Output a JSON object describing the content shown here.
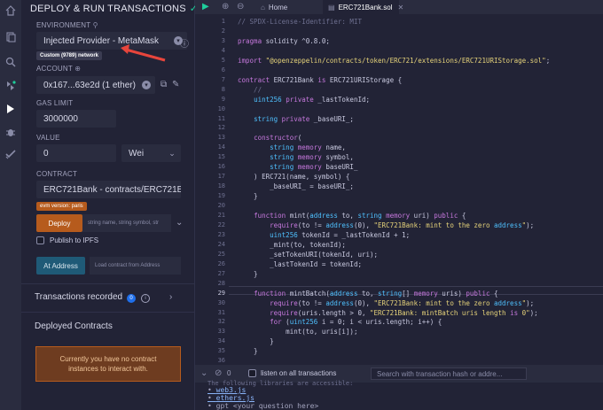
{
  "rail": {
    "icons": [
      "home-icon",
      "files-icon",
      "search-icon",
      "compile-icon",
      "deploy-icon",
      "debug-icon",
      "test-icon"
    ]
  },
  "panel": {
    "title": "DEPLOY & RUN TRANSACTIONS",
    "environment": {
      "label": "ENVIRONMENT",
      "value": "Injected Provider - MetaMask",
      "network_badge": "Custom (9789) network"
    },
    "account": {
      "label": "ACCOUNT",
      "value": "0x167...63e2d (1 ether)"
    },
    "gas_limit": {
      "label": "GAS LIMIT",
      "value": "3000000"
    },
    "value": {
      "label": "VALUE",
      "amount": "0",
      "unit": "Wei"
    },
    "contract": {
      "label": "CONTRACT",
      "value": "ERC721Bank - contracts/ERC721Bank",
      "evm_badge": "evm version: paris"
    },
    "deploy": {
      "button": "Deploy",
      "placeholder": "string name, string symbol, str"
    },
    "publish_ipfs": "Publish to IPFS",
    "at_address": {
      "button": "At Address",
      "placeholder": "Load contract from Address"
    },
    "transactions_recorded": {
      "label": "Transactions recorded",
      "count": "0"
    },
    "deployed_contracts": {
      "label": "Deployed Contracts",
      "empty_message": "Currently you have no contract instances to interact with."
    }
  },
  "editor": {
    "tabs": [
      {
        "label": "Home",
        "active": false
      },
      {
        "label": "ERC721Bank.sol",
        "active": true
      }
    ],
    "line_numbers": [
      "1",
      "2",
      "3",
      "4",
      "5",
      "6",
      "7",
      "8",
      "9",
      "10",
      "11",
      "12",
      "13",
      "14",
      "15",
      "16",
      "17",
      "18",
      "19",
      "20",
      "21",
      "22",
      "23",
      "24",
      "25",
      "26",
      "27",
      "28",
      "29",
      "30",
      "31",
      "32",
      "33",
      "34",
      "35",
      "36"
    ],
    "current_line": "29",
    "code_lines": [
      "// SPDX-License-Identifier: MIT",
      "",
      "pragma solidity ^0.8.0;",
      "",
      "import \"@openzeppelin/contracts/token/ERC721/extensions/ERC721URIStorage.sol\";",
      "",
      "contract ERC721Bank is ERC721URIStorage {",
      "    //",
      "    uint256 private _lastTokenId;",
      "",
      "    string private _baseURI_;",
      "",
      "    constructor(",
      "        string memory name,",
      "        string memory symbol,",
      "        string memory baseURI_",
      "    ) ERC721(name, symbol) {",
      "        _baseURI_ = baseURI_;",
      "    }",
      "",
      "    function mint(address to, string memory uri) public {",
      "        require(to != address(0), \"ERC721Bank: mint to the zero address\");",
      "        uint256 tokenId = _lastTokenId + 1;",
      "        _mint(to, tokenId);",
      "        _setTokenURI(tokenId, uri);",
      "        _lastTokenId = tokenId;",
      "    }",
      "",
      "    function mintBatch(address to, string[] memory uris) public {",
      "        require(to != address(0), \"ERC721Bank: mint to the zero address\");",
      "        require(uris.length > 0, \"ERC721Bank: mintBatch uris length is 0\");",
      "        for (uint256 i = 0; i < uris.length; i++) {",
      "            mint(to, uris[i]);",
      "        }",
      "    }",
      ""
    ]
  },
  "terminal": {
    "count": "0",
    "listen_label": "listen on all transactions",
    "search_placeholder": "Search with transaction hash or addre...",
    "lines": [
      {
        "text": "The following libraries are accessible:",
        "link": false
      },
      {
        "text": "web3.js",
        "link": true
      },
      {
        "text": "ethers.js",
        "link": true
      },
      {
        "text": "gpt <your question here>",
        "link": false
      }
    ]
  },
  "colors": {
    "background": "#222336",
    "accent_orange": "#b65b1d",
    "accent_green": "#1ece9b",
    "annotation_arrow": "#e8453c"
  }
}
